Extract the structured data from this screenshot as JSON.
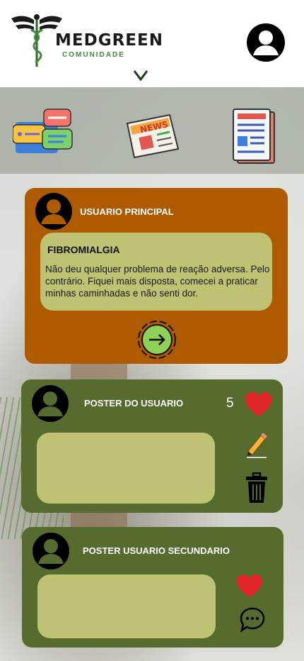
{
  "header": {
    "brand_title": "MEDGREEN",
    "brand_subtitle": "COMUNIDADE",
    "icons": [
      "caduceus-logo",
      "user-avatar-icon",
      "chevron-down-icon"
    ]
  },
  "topbar": {
    "icons": [
      "chat-bubbles-icon",
      "news-icon",
      "document-icon"
    ]
  },
  "main_card": {
    "user_label": "USUARIO PRINCIPAL",
    "topic": "FIBROMIALGIA",
    "text": "Não deu qualquer problema de reação adversa. Pelo contrário. Fiquei mais disposta, comecei a praticar minhas caminhadas e não senti dor.",
    "action_icon": "arrow-right-icon"
  },
  "poster_card": {
    "user_label": "POSTER DO USUARIO",
    "likes": "5",
    "icons": [
      "heart-icon",
      "pencil-icon",
      "trash-icon"
    ]
  },
  "secondary_card": {
    "user_label": "POSTER USUARIO SECUNDARIO",
    "icons": [
      "heart-icon",
      "comment-icon"
    ]
  },
  "colors": {
    "main_card": "#ad5a00",
    "poster_card": "#566b2e",
    "bubble": "#bfc273",
    "heart": "#e0262b",
    "arrow_button": "#8fd058"
  }
}
